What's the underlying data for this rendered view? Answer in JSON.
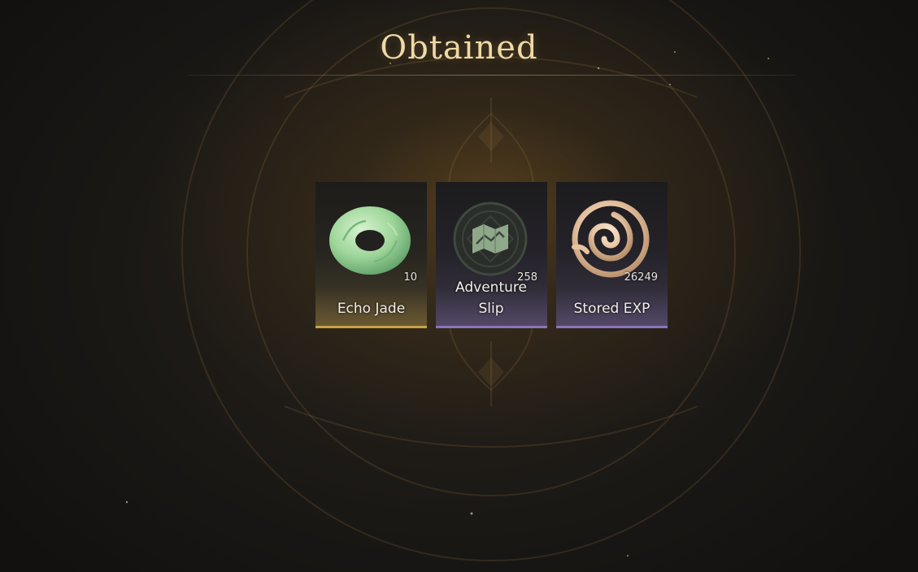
{
  "screen": {
    "title": "Obtained"
  },
  "items": [
    {
      "name": "Echo Jade",
      "quantity": "10",
      "icon": "jade-disc-icon",
      "rarity_color": "#c9a248"
    },
    {
      "name": "Adventure Slip",
      "quantity": "258",
      "icon": "map-slip-icon",
      "rarity_color": "#8a74b8"
    },
    {
      "name": "Stored EXP",
      "quantity": "26249",
      "icon": "spiral-exp-icon",
      "rarity_color": "#8a74b8"
    }
  ],
  "colors": {
    "title": "#efd9a4",
    "background": "#1a1815"
  }
}
